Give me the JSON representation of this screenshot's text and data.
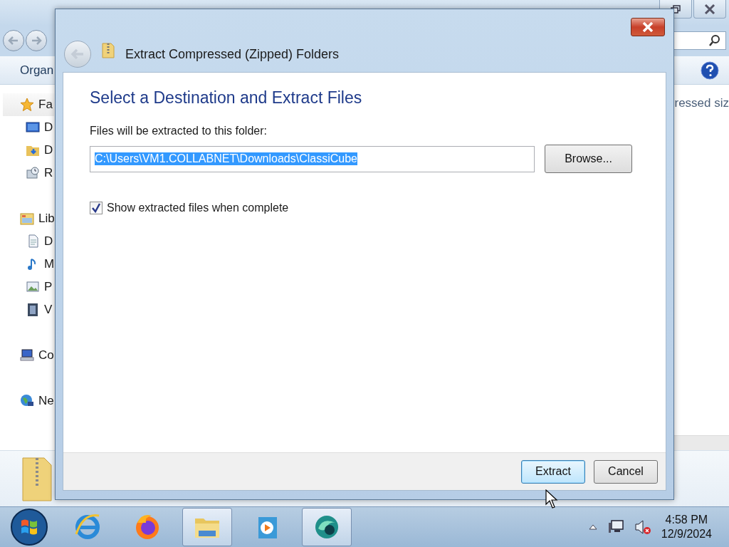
{
  "explorer": {
    "toolbar_label": "Organ",
    "column_header": "ressed siz",
    "sidebar": [
      {
        "label": "Fa",
        "kind": "star",
        "selected": true,
        "children": [
          {
            "label": "D",
            "kind": "desktop",
            "selected": false
          },
          {
            "label": "D",
            "kind": "downloads",
            "selected": false
          },
          {
            "label": "R",
            "kind": "recent",
            "selected": false
          }
        ]
      },
      {
        "label": "Lib",
        "kind": "library",
        "selected": false,
        "children": [
          {
            "label": "D",
            "kind": "documents",
            "selected": false
          },
          {
            "label": "M",
            "kind": "music",
            "selected": false
          },
          {
            "label": "P",
            "kind": "pictures",
            "selected": false
          },
          {
            "label": "V",
            "kind": "videos",
            "selected": false
          }
        ]
      },
      {
        "label": "Co",
        "kind": "computer",
        "selected": false
      },
      {
        "label": "Ne",
        "kind": "network",
        "selected": false
      }
    ]
  },
  "dialog": {
    "title": "Extract Compressed (Zipped) Folders",
    "heading": "Select a Destination and Extract Files",
    "field_label": "Files will be extracted to this folder:",
    "path": {
      "value": "C:\\Users\\VM1.COLLABNET\\Downloads\\ClassiCube",
      "selected": true
    },
    "browse": "Browse...",
    "checkbox": {
      "label": "Show extracted files when complete",
      "checked": true
    },
    "buttons": [
      {
        "label": "Extract",
        "default": true
      },
      {
        "label": "Cancel",
        "default": false
      }
    ]
  },
  "taskbar": {
    "apps": [
      {
        "kind": "ie",
        "active": false
      },
      {
        "kind": "firefox",
        "active": false
      },
      {
        "kind": "explorer",
        "active": true
      },
      {
        "kind": "media",
        "active": false
      },
      {
        "kind": "orb",
        "active": true
      }
    ],
    "time": "4:58 PM",
    "date": "12/9/2024"
  }
}
